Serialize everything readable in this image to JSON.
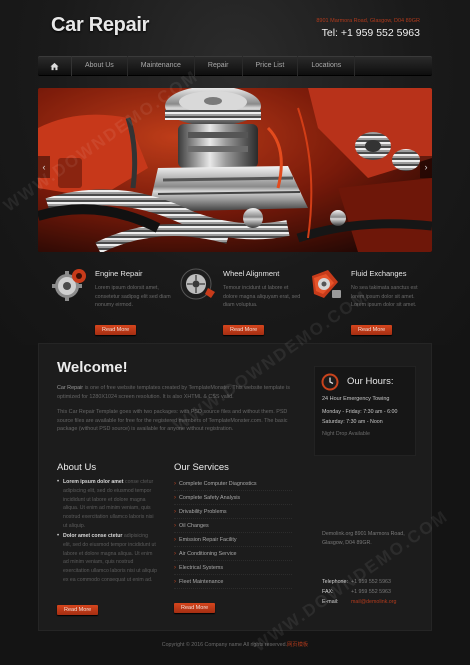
{
  "header": {
    "logo": "Car Repair",
    "address": "8901 Marmora Road, Glasgow, D04 89GR",
    "tel": "Tel: +1 959 552 5963"
  },
  "nav": {
    "home_icon": "home-icon",
    "items": [
      {
        "label": "About Us"
      },
      {
        "label": "Maintenance"
      },
      {
        "label": "Repair"
      },
      {
        "label": "Price List"
      },
      {
        "label": "Locations"
      }
    ]
  },
  "banner": {
    "prev": "‹",
    "next": "›"
  },
  "features": [
    {
      "icon": "engine-gear-icon",
      "title": "Engine Repair",
      "text": "Lorem ipsum dolorsit amet, consetetur sadipsg elit sed diam nonumy eirmod.",
      "button": "Read More"
    },
    {
      "icon": "wheel-icon",
      "title": "Wheel Alignment",
      "text": "Temour incidunt ut labore et dolore magna aliquyam erat, sed diam voluptua.",
      "button": "Read More"
    },
    {
      "icon": "fluid-can-icon",
      "title": "Fluid Exchanges",
      "text": "No sea takimata sanctus est lorem ipsum dolor sit amet. Lorem ipsum dolor sit amet.",
      "button": "Read More"
    }
  ],
  "welcome": {
    "title": "Welcome!",
    "p1_lead": "Car Repair",
    "p1": " is one of free website templates created by TemplateMonster. This website template is optimized for 1280X1024 screen resolution. It is also XHTML & CSS valid.",
    "p2": "This Car Repair Template goes with two packages: with PSD source files and without them. PSD source files are available for free for the registered members of TemplateMonster.com. The basic package (without PSD source) is available for anyone without registration."
  },
  "hours": {
    "title": "Our Hours:",
    "line1": "24 Hour Emergency Towing",
    "rows": [
      {
        "label": "Monday - Friday:",
        "value": "7:30 am - 6:00"
      },
      {
        "label": "Saturday:",
        "value": "7:30 am - Noon"
      }
    ],
    "note": "Night Drop Available"
  },
  "about": {
    "title": "About Us",
    "items": [
      {
        "lead": "Lorem ipsum dolor amet",
        "text": " conse ctetur adipiscing elit, sed do eiusmod tempor incididunt ut labore et dolore magna aliqua. Ut enim ad minim veniam, quis nostrud exercitation ullamco laboris nisi ut aliquip."
      },
      {
        "lead": "Dolor amet conse ctetur",
        "text": " adipisicing elit, sed do eiusmod tempor incididunt ut labore et dolore magna aliqua. Ut enim ad minim veniam, quis nostrud exercitation ullamco laboris nisi ut aliquip ex ea commodo consequat ut enim ad."
      }
    ],
    "button": "Read More"
  },
  "services": {
    "title": "Our Services",
    "items": [
      "Complete Computer Diagnostics",
      "Complete Safety Analysis",
      "Drivability Problems",
      "Oil Changes",
      "Emission Repair Facility",
      "Air Conditioning Service",
      "Electrical Systems",
      "Fleet Maintenance"
    ],
    "button": "Read More"
  },
  "contact": {
    "address": "Demolink.org 8901 Marmora Road, Glasgow, D04 89GR.",
    "telephone_label": "Telephone:",
    "telephone": "+1 959 552 5963",
    "fax_label": "FAX:",
    "fax": "+1 959 552 5963",
    "email_label": "E-mail:",
    "email": "mail@demolink.org"
  },
  "footer": {
    "text": "Copyright © 2016 Company name All rights reserved.",
    "link": "网页模板"
  },
  "watermark": "WWW.DOWNDEMO.COM",
  "colors": {
    "accent": "#c8431c",
    "background": "#141414",
    "panel": "#1c1c1c"
  }
}
